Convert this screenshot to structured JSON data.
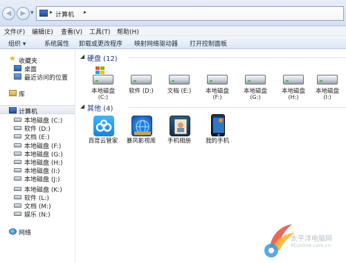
{
  "address": {
    "path_label": "计算机",
    "sep": "▸"
  },
  "menu": [
    {
      "label": "文件(F)"
    },
    {
      "label": "编辑(E)"
    },
    {
      "label": "查看(V)"
    },
    {
      "label": "工具(T)"
    },
    {
      "label": "帮助(H)"
    }
  ],
  "toolbar": [
    {
      "label": "组织 ▾"
    },
    {
      "label": "系统属性"
    },
    {
      "label": "卸载或更改程序"
    },
    {
      "label": "映射网络驱动器"
    },
    {
      "label": "打开控制面板"
    }
  ],
  "nav": {
    "favorites": "收藏夹",
    "desktop": "桌面",
    "recent": "最近访问的位置",
    "library": "库",
    "computer": "计算机",
    "drives": [
      "本地磁盘 (C:)",
      "软件 (D:)",
      "文档 (E:)",
      "本地磁盘 (F:)",
      "本地磁盘 (G:)",
      "本地磁盘 (H:)",
      "本地磁盘 (I:)",
      "本地磁盘 (J:)",
      "本地磁盘 (K:)",
      "软件 (L:)",
      "文档 (M:)",
      "娱乐 (N:)"
    ],
    "network": "网络"
  },
  "content": {
    "hard_disk_group": "硬盘 (12)",
    "hard_disks": [
      {
        "name": "本地磁盘",
        "letter": "(C:)"
      },
      {
        "name": "软件 (D:)",
        "letter": ""
      },
      {
        "name": "文档 (E:)",
        "letter": ""
      },
      {
        "name": "本地磁盘",
        "letter": "(F:)"
      },
      {
        "name": "本地磁盘",
        "letter": "(G:)"
      },
      {
        "name": "本地磁盘",
        "letter": "(H:)"
      },
      {
        "name": "本地磁盘",
        "letter": "(I:)"
      }
    ],
    "other_group": "其他 (4)",
    "others": [
      {
        "name": "百度云管家"
      },
      {
        "name": "暴风影视库"
      },
      {
        "name": "手机相册"
      },
      {
        "name": "我的手机"
      }
    ]
  },
  "watermark": {
    "text": "太平洋电脑网",
    "url": "PConline.com.cn"
  },
  "colors": {
    "group_title": "#1e3287",
    "accent_blue": "#2a5fb1"
  }
}
